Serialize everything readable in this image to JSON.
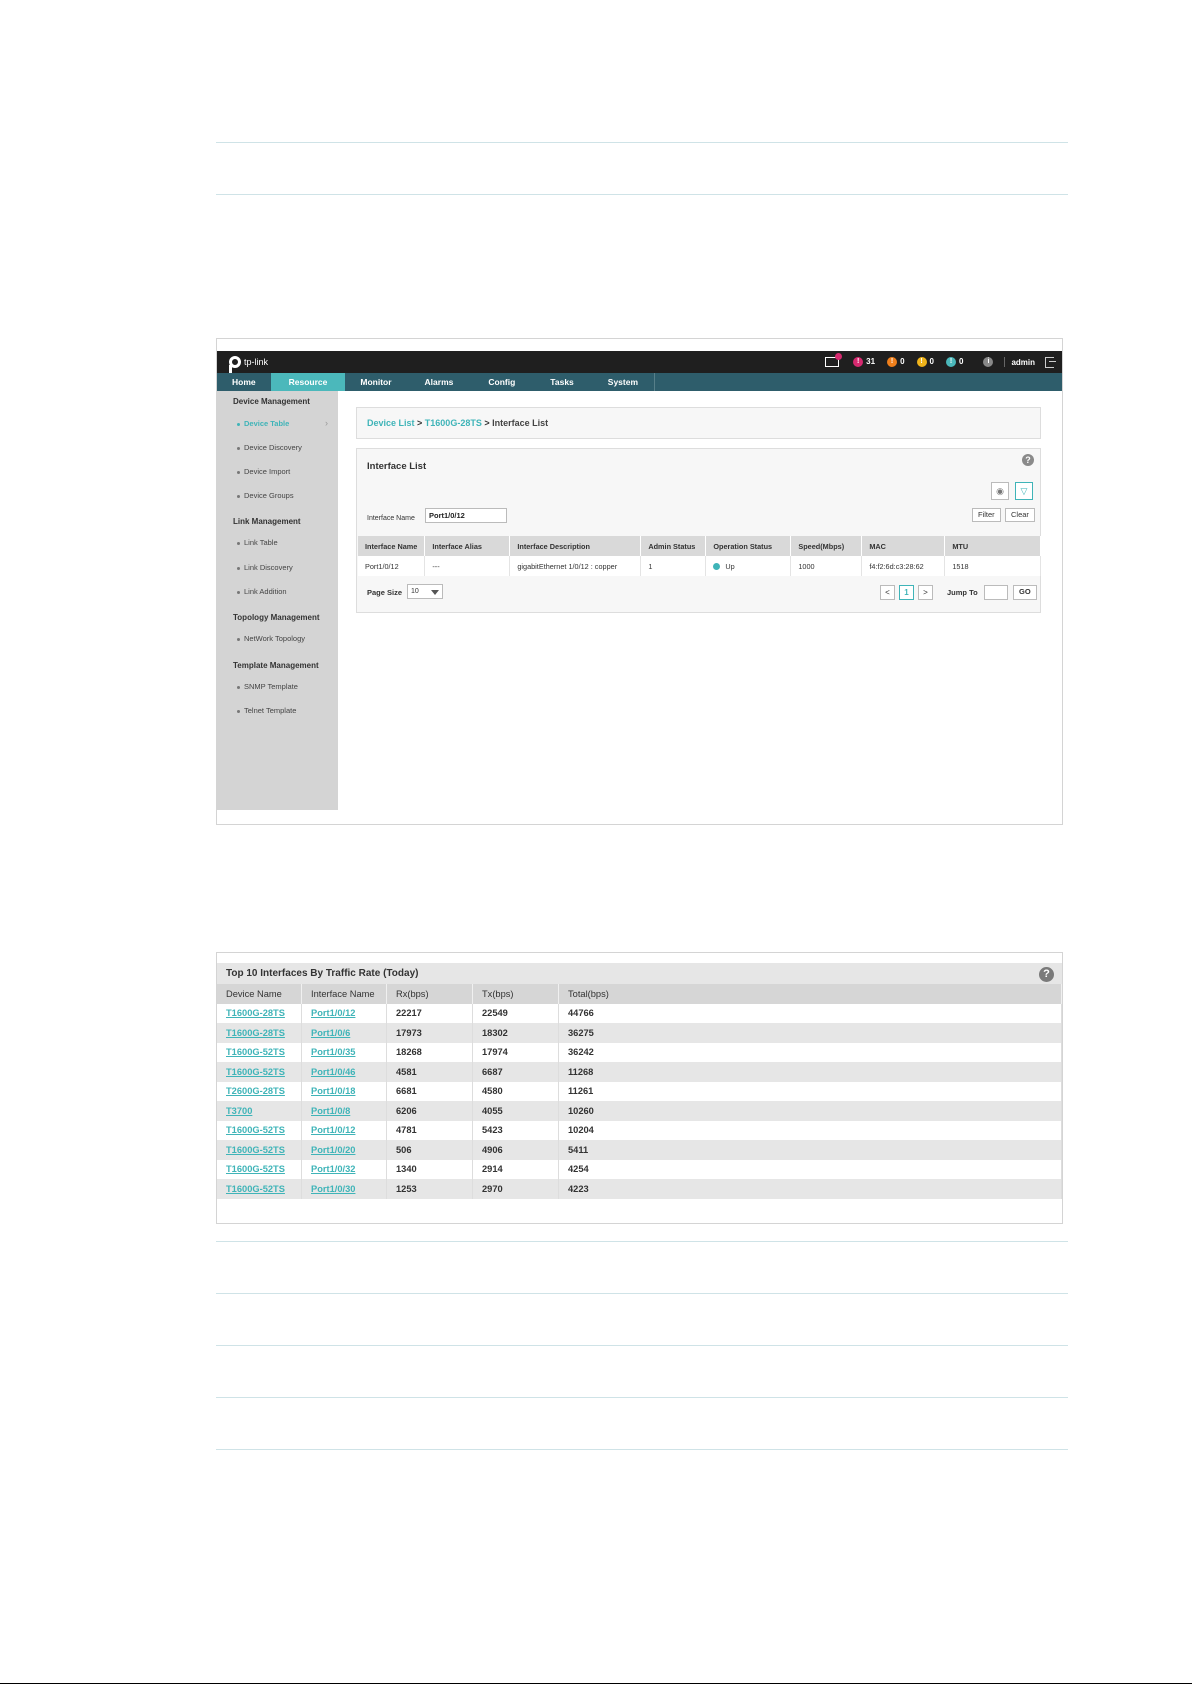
{
  "top_bar": {
    "logo": "tp-link",
    "mail_icon": "mail-icon",
    "alert_critical": "31",
    "alert_major": "0",
    "alert_minor": "0",
    "alert_info": "0",
    "info_icon": "i",
    "user": "admin",
    "colors": {
      "critical": "#d6296f",
      "major": "#f07f1b",
      "minor": "#f0b41b",
      "warning": "#4bb8bb"
    }
  },
  "nav": {
    "items": [
      "Home",
      "Resource",
      "Monitor",
      "Alarms",
      "Config",
      "Tasks",
      "System"
    ],
    "active": "Resource"
  },
  "sidebar": {
    "groups": [
      {
        "title": "Device Management",
        "items": [
          "Device Table",
          "Device Discovery",
          "Device Import",
          "Device Groups"
        ]
      },
      {
        "title": "Link Management",
        "items": [
          "Link Table",
          "Link Discovery",
          "Link Addition"
        ]
      },
      {
        "title": "Topology Management",
        "items": [
          "NetWork Topology"
        ]
      },
      {
        "title": "Template Management",
        "items": [
          "SNMP Template",
          "Telnet Template"
        ]
      }
    ],
    "active": "Device Table"
  },
  "breadcrumb": {
    "part1": "Device List",
    "sep1": " > ",
    "part2": "T1600G-28TS",
    "sep2": " > ",
    "current": "Interface List"
  },
  "interface_panel": {
    "title": "Interface List",
    "help": "?",
    "filter_label": "Interface Name",
    "filter_value": "Port1/0/12",
    "filter_button": "Filter",
    "clear_button": "Clear",
    "columns": [
      "Interface Name",
      "Interface Alias",
      "Interface Description",
      "Admin Status",
      "Operation Status",
      "Speed(Mbps)",
      "MAC",
      "MTU"
    ],
    "row": {
      "name": "Port1/0/12",
      "alias": "---",
      "description": "gigabitEthernet 1/0/12 : copper",
      "admin": "1",
      "oper": "Up",
      "speed": "1000",
      "mac": "f4:f2:6d:c3:28:62",
      "mtu": "1518"
    },
    "page_size_label": "Page Size",
    "page_size": "10",
    "prev": "<",
    "page": "1",
    "next": ">",
    "jump_label": "Jump To",
    "go": "GO"
  },
  "traffic_panel": {
    "title": "Top 10 Interfaces By Traffic Rate (Today)",
    "help": "?",
    "columns": [
      "Device Name",
      "Interface Name",
      "Rx(bps)",
      "Tx(bps)",
      "Total(bps)"
    ],
    "rows": [
      [
        "T1600G-28TS",
        "Port1/0/12",
        "22217",
        "22549",
        "44766"
      ],
      [
        "T1600G-28TS",
        "Port1/0/6",
        "17973",
        "18302",
        "36275"
      ],
      [
        "T1600G-52TS",
        "Port1/0/35",
        "18268",
        "17974",
        "36242"
      ],
      [
        "T1600G-52TS",
        "Port1/0/46",
        "4581",
        "6687",
        "11268"
      ],
      [
        "T2600G-28TS",
        "Port1/0/18",
        "6681",
        "4580",
        "11261"
      ],
      [
        "T3700",
        "Port1/0/8",
        "6206",
        "4055",
        "10260"
      ],
      [
        "T1600G-52TS",
        "Port1/0/12",
        "4781",
        "5423",
        "10204"
      ],
      [
        "T1600G-52TS",
        "Port1/0/20",
        "506",
        "4906",
        "5411"
      ],
      [
        "T1600G-52TS",
        "Port1/0/32",
        "1340",
        "2914",
        "4254"
      ],
      [
        "T1600G-52TS",
        "Port1/0/30",
        "1253",
        "2970",
        "4223"
      ]
    ]
  }
}
